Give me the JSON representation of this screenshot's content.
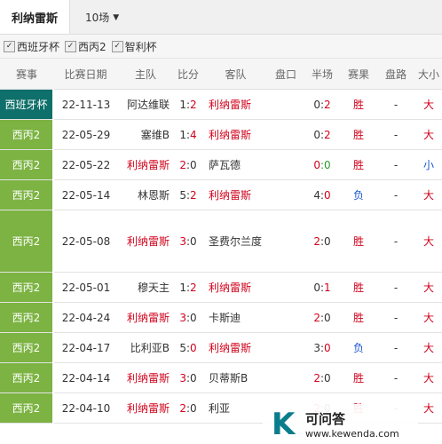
{
  "header": {
    "team": "利纳雷斯",
    "count": "10场"
  },
  "filters": [
    {
      "label": "西班牙杯",
      "checked": true
    },
    {
      "label": "西丙2",
      "checked": true
    },
    {
      "label": "智利杯",
      "checked": true
    }
  ],
  "columns": [
    "赛事",
    "比赛日期",
    "主队",
    "比分",
    "客队",
    "盘口",
    "半场",
    "赛果",
    "盘路",
    "大小"
  ],
  "rows": [
    {
      "league": "西班牙杯",
      "date": "22-11-13",
      "home": "阿达维联",
      "s1": "1",
      "s2": "2",
      "away": "利纳雷斯",
      "ht1": "0",
      "ht2": "2",
      "result": "胜",
      "pan": "-",
      "ou": "大"
    },
    {
      "league": "西丙2",
      "date": "22-05-29",
      "home": "塞维B",
      "s1": "1",
      "s2": "4",
      "away": "利纳雷斯",
      "ht1": "0",
      "ht2": "2",
      "result": "胜",
      "pan": "-",
      "ou": "大"
    },
    {
      "league": "西丙2",
      "date": "22-05-22",
      "home": "利纳雷斯",
      "s1": "2",
      "s2": "0",
      "away": "萨瓦德",
      "ht1": "0",
      "ht2": "0",
      "result": "胜",
      "pan": "-",
      "ou": "小"
    },
    {
      "league": "西丙2",
      "date": "22-05-14",
      "home": "林恩斯",
      "s1": "5",
      "s2": "2",
      "away": "利纳雷斯",
      "ht1": "4",
      "ht2": "0",
      "result": "负",
      "pan": "-",
      "ou": "大"
    },
    {
      "league": "西丙2",
      "date": "22-05-08",
      "home": "利纳雷斯",
      "s1": "3",
      "s2": "0",
      "away": "圣费尔兰度",
      "ht1": "2",
      "ht2": "0",
      "result": "胜",
      "pan": "-",
      "ou": "大"
    },
    {
      "league": "西丙2",
      "date": "22-05-01",
      "home": "穆天主",
      "s1": "1",
      "s2": "2",
      "away": "利纳雷斯",
      "ht1": "0",
      "ht2": "1",
      "result": "胜",
      "pan": "-",
      "ou": "大"
    },
    {
      "league": "西丙2",
      "date": "22-04-24",
      "home": "利纳雷斯",
      "s1": "3",
      "s2": "0",
      "away": "卡斯迪",
      "ht1": "2",
      "ht2": "0",
      "result": "胜",
      "pan": "-",
      "ou": "大"
    },
    {
      "league": "西丙2",
      "date": "22-04-17",
      "home": "比利亚B",
      "s1": "5",
      "s2": "0",
      "away": "利纳雷斯",
      "ht1": "3",
      "ht2": "0",
      "result": "负",
      "pan": "-",
      "ou": "大"
    },
    {
      "league": "西丙2",
      "date": "22-04-14",
      "home": "利纳雷斯",
      "s1": "3",
      "s2": "0",
      "away": "贝蒂斯B",
      "ht1": "2",
      "ht2": "0",
      "result": "胜",
      "pan": "-",
      "ou": "大"
    },
    {
      "league": "西丙2",
      "date": "22-04-10",
      "home": "利纳雷斯",
      "s1": "2",
      "s2": "0",
      "away": "利亚",
      "ht1": "2",
      "ht2": "0",
      "result": "胜",
      "pan": "-",
      "ou": "大"
    }
  ],
  "watermark": {
    "logo": "K",
    "title": "可问答",
    "url": "www.kewenda.com"
  }
}
